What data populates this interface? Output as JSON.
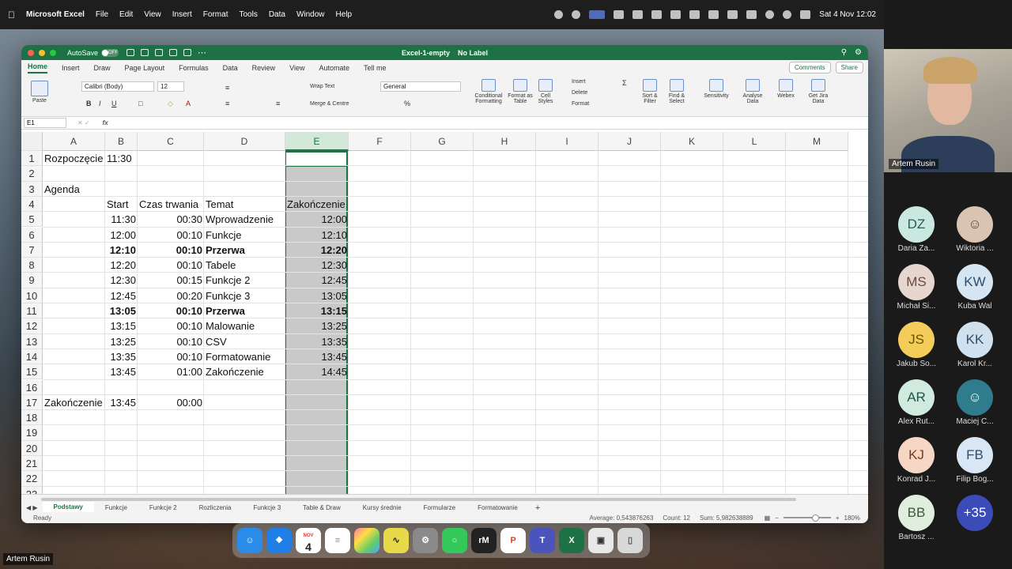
{
  "menubar": {
    "app_name": "Microsoft Excel",
    "items": [
      "File",
      "Edit",
      "View",
      "Insert",
      "Format",
      "Tools",
      "Data",
      "Window",
      "Help"
    ],
    "clock": "Sat 4 Nov  12:02"
  },
  "titlebar": {
    "autosave_label": "AutoSave",
    "autosave_state": "OFF",
    "doc_title": "Excel-1-empty",
    "label": "No Label"
  },
  "ribbon_tabs": [
    "Home",
    "Insert",
    "Draw",
    "Page Layout",
    "Formulas",
    "Data",
    "Review",
    "View",
    "Automate",
    "Tell me"
  ],
  "ribbon_buttons": {
    "comments": "Comments",
    "share": "Share",
    "paste": "Paste",
    "font_name": "Calibri (Body)",
    "font_size": "12",
    "wrap_text": "Wrap Text",
    "merge_centre": "Merge & Centre",
    "number_format": "General",
    "conditional": "Conditional Formatting",
    "format_table": "Format as Table",
    "cell_styles": "Cell Styles",
    "insert": "Insert",
    "delete": "Delete",
    "format": "Format",
    "sort_filter": "Sort & Filter",
    "find_select": "Find & Select",
    "sensitivity": "Sensitivity",
    "analyse": "Analyse Data",
    "webex": "Webex",
    "jira": "Get Jira Data"
  },
  "formula_bar": {
    "name_box": "E1",
    "fx": "fx"
  },
  "columns": [
    "A",
    "B",
    "C",
    "D",
    "E",
    "F",
    "G",
    "H",
    "I",
    "J",
    "K",
    "L",
    "M"
  ],
  "selected_column": "E",
  "rows": [
    "1",
    "2",
    "3",
    "4",
    "5",
    "6",
    "7",
    "8",
    "9",
    "10",
    "11",
    "12",
    "13",
    "14",
    "15",
    "16",
    "17",
    "18",
    "19",
    "20",
    "21",
    "22",
    "23"
  ],
  "cells": {
    "A1": "Rozpoczęcie",
    "B1": "11:30",
    "A3": "Agenda",
    "B4": "Start",
    "C4": "Czas trwania",
    "D4": "Temat",
    "E4": "Zakończenie",
    "B5": "11:30",
    "C5": "00:30",
    "D5": "Wprowadzenie",
    "E5": "12:00",
    "B6": "12:00",
    "C6": "00:10",
    "D6": "Funkcje",
    "E6": "12:10",
    "B7": "12:10",
    "C7": "00:10",
    "D7": "Przerwa",
    "E7": "12:20",
    "B8": "12:20",
    "C8": "00:10",
    "D8": "Tabele",
    "E8": "12:30",
    "B9": "12:30",
    "C9": "00:15",
    "D9": "Funkcje 2",
    "E9": "12:45",
    "B10": "12:45",
    "C10": "00:20",
    "D10": "Funkcje 3",
    "E10": "13:05",
    "B11": "13:05",
    "C11": "00:10",
    "D11": "Przerwa",
    "E11": "13:15",
    "B12": "13:15",
    "C12": "00:10",
    "D12": "Malowanie",
    "E12": "13:25",
    "B13": "13:25",
    "C13": "00:10",
    "D13": "CSV",
    "E13": "13:35",
    "B14": "13:35",
    "C14": "00:10",
    "D14": "Formatowanie",
    "E14": "13:45",
    "B15": "13:45",
    "C15": "01:00",
    "D15": "Zakończenie",
    "E15": "14:45",
    "A17": "Zakończenie",
    "B17": "13:45",
    "C17": "00:00"
  },
  "sheet_tabs": [
    "Podstawy",
    "Funkcje",
    "Funkcje 2",
    "Rozliczenia",
    "Funkcje 3",
    "Table & Draw",
    "Kursy średnie",
    "Formularze",
    "Formatowanie"
  ],
  "active_sheet": "Podstawy",
  "status": {
    "ready": "Ready",
    "average": "Average: 0,543876263",
    "count": "Count: 12",
    "sum": "Sum: 5,982638889",
    "zoom": "180%"
  },
  "dock_apps": [
    "Finder",
    "Safari",
    "Calendar",
    "Reminders",
    "Photos",
    "Activity",
    "Settings",
    "Messages",
    "reMarkable",
    "PowerPoint",
    "Teams",
    "Excel",
    "Preview",
    "Trash"
  ],
  "dock_calendar": {
    "month": "NOV",
    "day": "4"
  },
  "video_participant": {
    "name": "Artem Rusin"
  },
  "participants": [
    {
      "initials": "DZ",
      "name": "Daria Za...",
      "color": "#c9e9e0",
      "text": "#2a5d52"
    },
    {
      "initials": "",
      "name": "Wiktoria ...",
      "color": "#d8c4b0",
      "text": "#5a4030"
    },
    {
      "initials": "MS",
      "name": "Michał Si...",
      "color": "#e6d6cf",
      "text": "#6b4a3d"
    },
    {
      "initials": "KW",
      "name": "Kuba Wal",
      "color": "#d6e5f2",
      "text": "#2c4f6e"
    },
    {
      "initials": "JS",
      "name": "Jakub So...",
      "color": "#f4cc5a",
      "text": "#6b4f00"
    },
    {
      "initials": "KK",
      "name": "Karol Kr...",
      "color": "#cfe0ef",
      "text": "#2c4f6e"
    },
    {
      "initials": "AR",
      "name": "Alex Rut...",
      "color": "#d0eadf",
      "text": "#245544"
    },
    {
      "initials": "",
      "name": "Maciej C...",
      "color": "#2f7c8c",
      "text": "#ffffff"
    },
    {
      "initials": "KJ",
      "name": "Konrad J...",
      "color": "#f6d7c6",
      "text": "#7a3a1f"
    },
    {
      "initials": "FB",
      "name": "Filip Bog...",
      "color": "#d9e6f3",
      "text": "#2c4f6e"
    },
    {
      "initials": "BB",
      "name": "Bartosz ...",
      "color": "#dfeedd",
      "text": "#3b5a36"
    },
    {
      "initials": "+35",
      "name": "",
      "color": "#3b4cb8",
      "text": "#ffffff"
    }
  ],
  "bottom_name": "Artem Rusin"
}
